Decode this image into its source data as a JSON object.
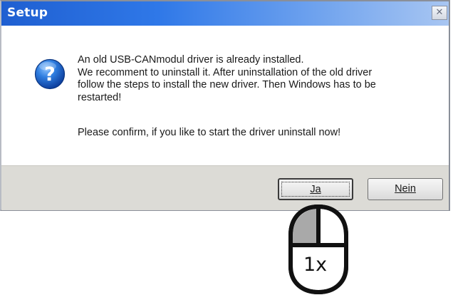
{
  "window": {
    "title": "Setup",
    "close_glyph": "✕"
  },
  "message": {
    "icon": "question-icon",
    "lines": [
      "An old USB-CANmodul driver is already installed.",
      "We recomment to uninstall it. After uninstallation of the old driver",
      "follow the steps to install the new driver. Then Windows has to be",
      "restarted!"
    ],
    "confirm": "Please confirm, if you like to start the driver uninstall now!"
  },
  "buttons": {
    "yes_label": "Ja",
    "no_label": "Nein"
  },
  "annotation": {
    "icon": "mouse-left-click-icon",
    "clicks": "1x"
  }
}
